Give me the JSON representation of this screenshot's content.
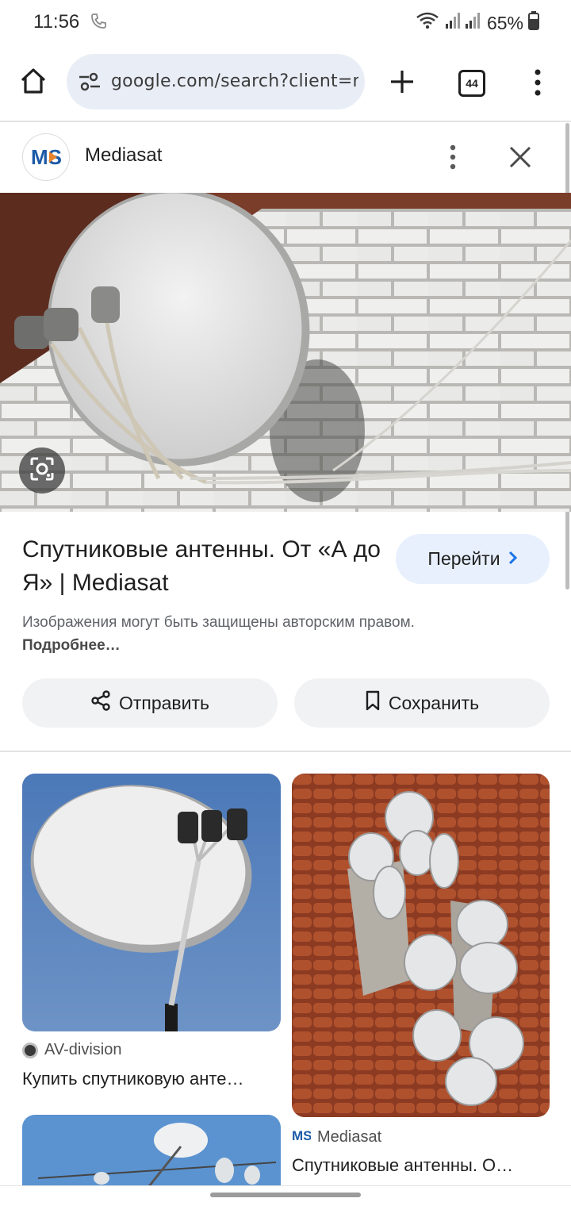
{
  "status": {
    "time": "11:56",
    "battery": "65%"
  },
  "browser": {
    "url": "google.com/search?client=ms-a",
    "tab_count": "44"
  },
  "panel": {
    "site_name": "Mediasat",
    "title": "Спутниковые антенны. От «А до Я» | Mediasat",
    "go_label": "Перейти",
    "copyright_text": "Изображения могут быть защищены авторским правом.",
    "more_link": "Подробнее…",
    "share_label": "Отправить",
    "save_label": "Сохранить"
  },
  "related": [
    {
      "source": "AV-division",
      "caption": "Купить спутниковую анте…"
    },
    {
      "source": "Mediasat",
      "caption": "Спутниковые антенны. О…"
    }
  ],
  "icons": [
    "phone-icon",
    "wifi-icon",
    "signal-icon",
    "battery-icon",
    "home-icon",
    "site-settings-icon",
    "new-tab-icon",
    "tab-switcher-icon",
    "overflow-menu-icon",
    "close-icon",
    "lens-icon",
    "share-icon",
    "bookmark-icon",
    "chevron-right-icon"
  ],
  "colors": {
    "accent_button": "#e8f0fe",
    "url_bar": "#e9eef6",
    "pill": "#f0f2f4"
  }
}
